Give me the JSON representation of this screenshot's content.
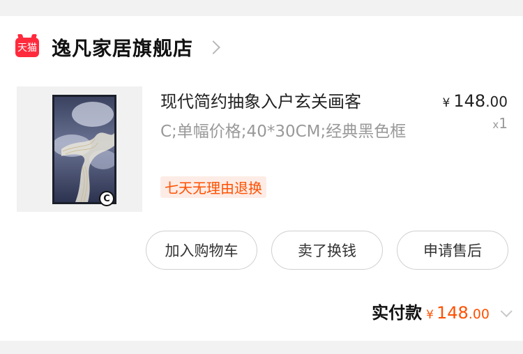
{
  "shop": {
    "badge_text": "天猫",
    "name": "逸凡家居旗舰店"
  },
  "item": {
    "title": "现代简约抽象入户玄关画客",
    "spec": "C;单幅价格;40*30CM;经典黑色框",
    "tag": "七天无理由退换",
    "price_currency": "¥",
    "price_int": "148",
    "price_dec": ".00",
    "qty_prefix": "x",
    "qty": "1",
    "copyright_mark": "C"
  },
  "actions": {
    "add_to_cart": "加入购物车",
    "resell": "卖了换钱",
    "after_sale": "申请售后"
  },
  "total": {
    "label": "实付款",
    "currency": "¥",
    "int": "148",
    "dec": ".00"
  },
  "colors": {
    "accent": "#ff5000",
    "tmall_red": "#ff2a3c",
    "tag_bg": "#fdece6"
  }
}
